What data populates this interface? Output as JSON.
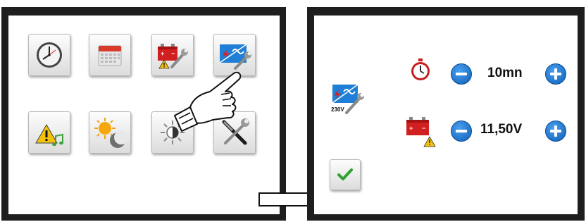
{
  "left_panel": {
    "menu_tiles": [
      {
        "name": "clock"
      },
      {
        "name": "calendar"
      },
      {
        "name": "battery-maintenance"
      },
      {
        "name": "inverter-settings"
      },
      {
        "name": "alarm-sound"
      },
      {
        "name": "day-night"
      },
      {
        "name": "brightness"
      },
      {
        "name": "tools"
      }
    ]
  },
  "right_panel": {
    "inverter_label": "230V",
    "timer_value": "10mn",
    "voltage_value": "11,50V"
  },
  "colors": {
    "accent_blue": "#1f7fd6",
    "confirm_green": "#2ea12e",
    "battery_red": "#d21f1f",
    "frame": "#1e1e1e"
  }
}
